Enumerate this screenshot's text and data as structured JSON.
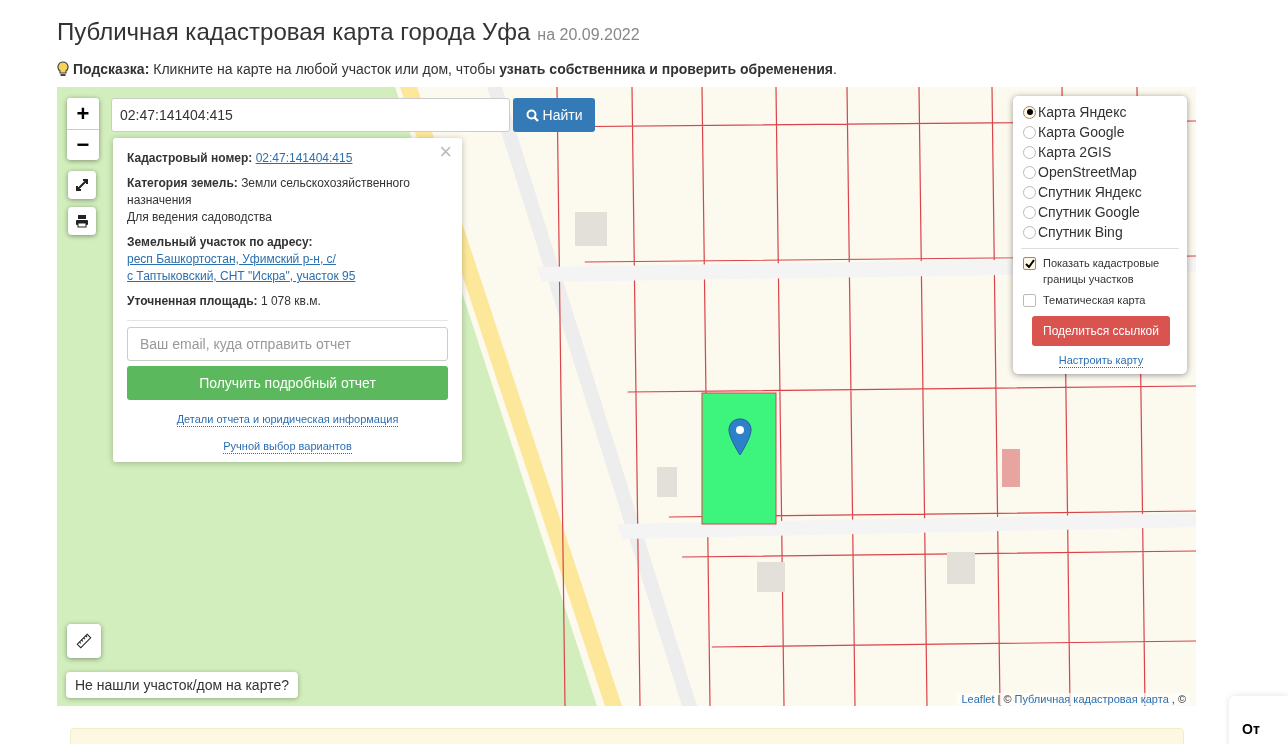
{
  "header": {
    "title": "Публичная кадастровая карта города Уфа",
    "date": "на 20.09.2022"
  },
  "hint": {
    "label": "Подсказка:",
    "text": "Кликните на карте на любой участок или дом, чтобы **узнать собственника и проверить обременения**."
  },
  "map": {
    "zoom_in": "+",
    "zoom_out": "−",
    "search": {
      "value": "02:47:141404:415",
      "button": "Найти"
    },
    "popup": {
      "close": "×",
      "cadastral": {
        "label": "Кадастровый номер:",
        "value": "02:47:141404:415"
      },
      "category": {
        "label": "Категория земель:",
        "value": "Земли сельскохозяйственного назначения",
        "purpose": "Для ведения садоводства"
      },
      "address": {
        "label": "Земельный участок по адресу:",
        "lines": [
          "респ Башкортостан, Уфимский р-н, с/",
          "с Таптыковский, СНТ \"Искра\", участок 95"
        ]
      },
      "area": {
        "label": "Уточненная площадь:",
        "value": "1 078 кв.м."
      },
      "email": {
        "placeholder": "Ваш email, куда отправить отчет"
      },
      "report_button": "Получить подробный отчет",
      "links": [
        "Детали отчета и юридическая информация",
        "Ручной выбор вариантов"
      ]
    },
    "layers": [
      {
        "label": "Карта Яндекс",
        "selected": true
      },
      {
        "label": "Карта Google",
        "selected": false
      },
      {
        "label": "Карта 2GIS",
        "selected": false
      },
      {
        "label": "OpenStreetMap",
        "selected": false
      },
      {
        "label": "Спутник Яндекс",
        "selected": false
      },
      {
        "label": "Спутник Google",
        "selected": false
      },
      {
        "label": "Спутник Bing",
        "selected": false
      }
    ],
    "options": [
      {
        "label": "Показать кадастровые границы участков",
        "checked": true
      },
      {
        "label": "Тематическая карта",
        "checked": false
      }
    ],
    "share_button": "Поделиться ссылкой",
    "settings_link": "Настроить карту",
    "not_found": "Не нашли участок/дом на карте?",
    "attribution": [
      {
        "text": "Leaflet",
        "kind": "link"
      },
      {
        "text": "| ©",
        "kind": "text"
      },
      {
        "text": "Публичная кадастровая карта",
        "kind": "link"
      },
      {
        "text": ", ©",
        "kind": "text"
      }
    ]
  },
  "side_card": {
    "text": "От"
  }
}
